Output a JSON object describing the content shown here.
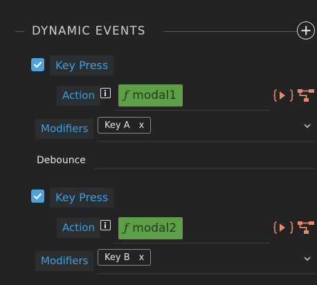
{
  "header": {
    "title": "DYNAMIC EVENTS",
    "add_icon": "plus-circle-icon"
  },
  "events": [
    {
      "enabled": true,
      "event_label": "Key Press",
      "action_label": "Action",
      "action_value": "modal1",
      "function_symbol": "ƒ",
      "modifiers_label": "Modifiers",
      "modifier_chip": "Key A",
      "chip_remove": "x",
      "debounce_label": "Debounce"
    },
    {
      "enabled": true,
      "event_label": "Key Press",
      "action_label": "Action",
      "action_value": "modal2",
      "function_symbol": "ƒ",
      "modifiers_label": "Modifiers",
      "modifier_chip": "Key B",
      "chip_remove": "x"
    }
  ],
  "colors": {
    "background": "#232323",
    "accent_blue": "#3d9fe0",
    "checkbox_blue": "#4fa3dc",
    "function_green": "#5d9f45",
    "icon_orange": "#e8896a"
  }
}
